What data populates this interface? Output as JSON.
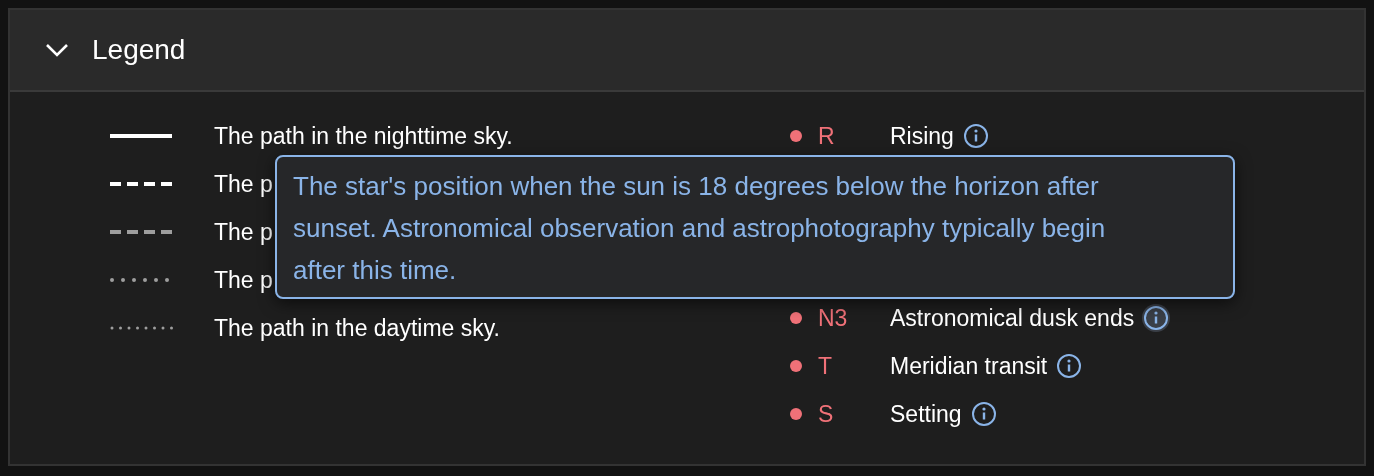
{
  "legend": {
    "title": "Legend",
    "expanded": true,
    "paths": [
      {
        "kind": "solid",
        "color": "#ffffff",
        "text": "The path in the nighttime sky."
      },
      {
        "kind": "dashed",
        "color": "#ffffff",
        "text": "The p"
      },
      {
        "kind": "dashed",
        "color": "#9e9e9e",
        "text": "The p"
      },
      {
        "kind": "dotted",
        "color": "#9e9e9e",
        "text": "The p"
      },
      {
        "kind": "fine",
        "color": "#9e9e9e",
        "text": "The path in the daytime sky."
      }
    ],
    "events_before": [
      {
        "code": "R",
        "label": "Rising",
        "hovered": false
      }
    ],
    "tooltip": "The star's position when the sun is 18 degrees below the horizon after sunset. Astronomical observation and astrophotography typically begin after this time.",
    "events_after": [
      {
        "code": "N3",
        "label": "Astronomical dusk ends",
        "hovered": true
      },
      {
        "code": "T",
        "label": "Meridian transit",
        "hovered": false
      },
      {
        "code": "S",
        "label": "Setting",
        "hovered": false
      }
    ]
  }
}
